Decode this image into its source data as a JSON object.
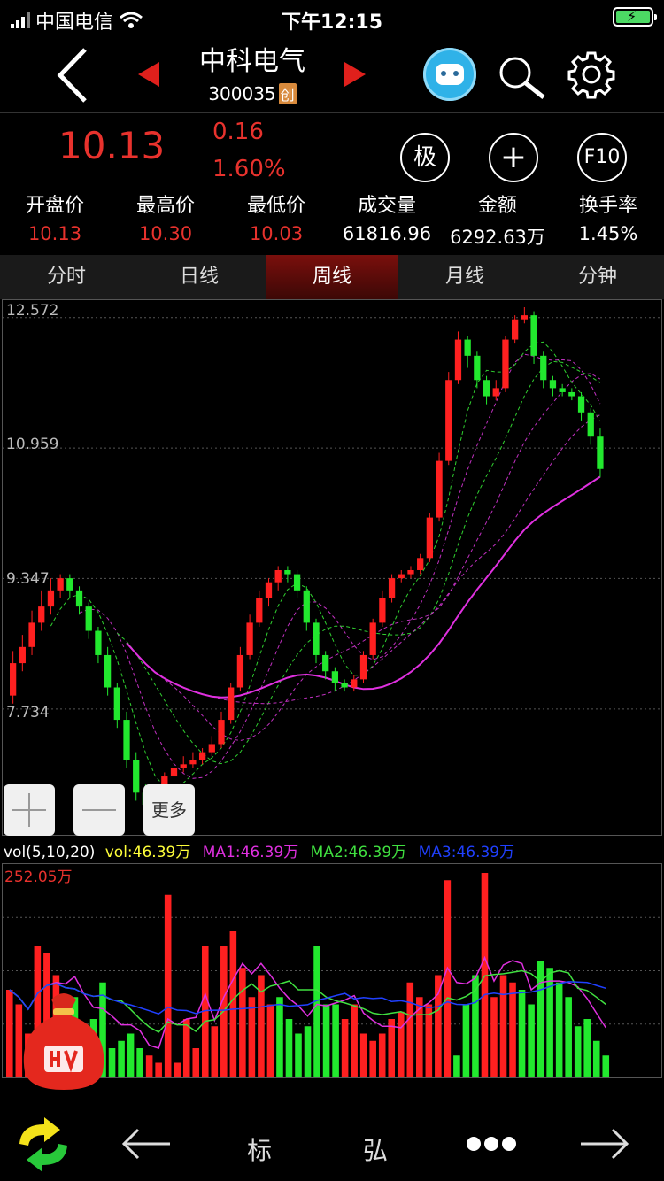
{
  "status": {
    "carrier": "中国电信",
    "time": "下午12:15"
  },
  "header": {
    "name": "中科电气",
    "code": "300035",
    "board": "创"
  },
  "quote": {
    "price": "10.13",
    "change": "0.16",
    "change_pct": "1.60%",
    "buttons": [
      "极",
      "+",
      "F10"
    ],
    "stats": [
      {
        "label": "开盘价",
        "value": "10.13"
      },
      {
        "label": "最高价",
        "value": "10.30"
      },
      {
        "label": "最低价",
        "value": "10.03"
      },
      {
        "label": "成交量",
        "value": "61816.96"
      },
      {
        "label": "金额",
        "value": "6292.63万"
      },
      {
        "label": "换手率",
        "value": "1.45%"
      }
    ]
  },
  "tabs": [
    "分时",
    "日线",
    "周线",
    "月线",
    "分钟"
  ],
  "active_tab": 2,
  "controls": {
    "more": "更多"
  },
  "vol_legend": {
    "title": "vol(5,10,20)",
    "vol": "vol:46.39万",
    "ma1": "MA1:46.39万",
    "ma2": "MA2:46.39万",
    "ma3": "MA3:46.39万"
  },
  "bottom": {
    "biao": "标",
    "hong": "弘"
  },
  "colors": {
    "up": "#ff2020",
    "down": "#22e82e",
    "accent": "#e8322d"
  },
  "chart_data": {
    "type": "candlestick",
    "y_ticks": [
      "12.572",
      "10.959",
      "9.347",
      "7.734"
    ],
    "ylim": [
      6.2,
      12.7
    ],
    "candles": [
      [
        7.9,
        8.3,
        8.45,
        7.8
      ],
      [
        8.3,
        8.5,
        8.65,
        8.2
      ],
      [
        8.5,
        8.8,
        8.95,
        8.4
      ],
      [
        8.8,
        9.0,
        9.2,
        8.7
      ],
      [
        9.0,
        9.2,
        9.35,
        8.9
      ],
      [
        9.2,
        9.35,
        9.4,
        9.1
      ],
      [
        9.35,
        9.2,
        9.4,
        9.1
      ],
      [
        9.2,
        9.0,
        9.25,
        8.9
      ],
      [
        9.0,
        8.7,
        9.05,
        8.6
      ],
      [
        8.7,
        8.4,
        8.75,
        8.3
      ],
      [
        8.4,
        8.0,
        8.5,
        7.9
      ],
      [
        8.0,
        7.6,
        8.05,
        7.5
      ],
      [
        7.6,
        7.1,
        7.7,
        7.0
      ],
      [
        7.1,
        6.7,
        7.2,
        6.6
      ],
      [
        6.7,
        6.55,
        6.8,
        6.5
      ],
      [
        6.55,
        6.6,
        6.7,
        6.5
      ],
      [
        6.6,
        6.9,
        6.95,
        6.55
      ],
      [
        6.9,
        7.0,
        7.1,
        6.85
      ],
      [
        7.0,
        7.05,
        7.15,
        6.95
      ],
      [
        7.05,
        7.1,
        7.2,
        7.0
      ],
      [
        7.1,
        7.2,
        7.25,
        7.05
      ],
      [
        7.2,
        7.3,
        7.4,
        7.15
      ],
      [
        7.3,
        7.6,
        7.7,
        7.25
      ],
      [
        7.6,
        8.0,
        8.05,
        7.55
      ],
      [
        8.0,
        8.4,
        8.5,
        7.95
      ],
      [
        8.4,
        8.8,
        8.9,
        8.35
      ],
      [
        8.8,
        9.1,
        9.2,
        8.75
      ],
      [
        9.1,
        9.3,
        9.35,
        9.0
      ],
      [
        9.3,
        9.45,
        9.5,
        9.2
      ],
      [
        9.45,
        9.4,
        9.5,
        9.3
      ],
      [
        9.4,
        9.2,
        9.45,
        9.1
      ],
      [
        9.2,
        8.8,
        9.25,
        8.7
      ],
      [
        8.8,
        8.4,
        8.85,
        8.3
      ],
      [
        8.4,
        8.2,
        8.45,
        8.1
      ],
      [
        8.2,
        8.05,
        8.25,
        7.95
      ],
      [
        8.05,
        8.0,
        8.1,
        7.95
      ],
      [
        8.0,
        8.1,
        8.15,
        7.95
      ],
      [
        8.1,
        8.4,
        8.45,
        8.05
      ],
      [
        8.4,
        8.8,
        8.85,
        8.35
      ],
      [
        8.8,
        9.1,
        9.2,
        8.75
      ],
      [
        9.1,
        9.35,
        9.4,
        9.05
      ],
      [
        9.35,
        9.4,
        9.45,
        9.3
      ],
      [
        9.4,
        9.45,
        9.5,
        9.35
      ],
      [
        9.45,
        9.6,
        9.65,
        9.4
      ],
      [
        9.6,
        10.1,
        10.15,
        9.55
      ],
      [
        10.1,
        10.8,
        10.9,
        10.05
      ],
      [
        10.8,
        11.8,
        11.9,
        10.75
      ],
      [
        11.8,
        12.3,
        12.4,
        11.75
      ],
      [
        12.3,
        12.1,
        12.35,
        11.95
      ],
      [
        12.1,
        11.8,
        12.15,
        11.7
      ],
      [
        11.8,
        11.6,
        11.85,
        11.5
      ],
      [
        11.6,
        11.7,
        11.8,
        11.55
      ],
      [
        11.7,
        12.3,
        12.35,
        11.65
      ],
      [
        12.3,
        12.55,
        12.6,
        12.25
      ],
      [
        12.55,
        12.6,
        12.7,
        12.5
      ],
      [
        12.6,
        12.1,
        12.65,
        12.0
      ],
      [
        12.1,
        11.8,
        12.15,
        11.7
      ],
      [
        11.8,
        11.7,
        11.85,
        11.6
      ],
      [
        11.7,
        11.65,
        11.75,
        11.6
      ],
      [
        11.65,
        11.6,
        11.7,
        11.55
      ],
      [
        11.6,
        11.4,
        11.65,
        11.3
      ],
      [
        11.4,
        11.1,
        11.45,
        11.0
      ],
      [
        11.1,
        10.7,
        11.2,
        10.6
      ]
    ],
    "vol_ylabel": "252.05万",
    "volumes": [
      120,
      100,
      60,
      180,
      170,
      140,
      90,
      110,
      60,
      80,
      130,
      40,
      50,
      60,
      40,
      30,
      20,
      250,
      20,
      80,
      40,
      180,
      70,
      180,
      200,
      150,
      110,
      140,
      100,
      110,
      80,
      60,
      70,
      180,
      100,
      100,
      80,
      100,
      60,
      50,
      60,
      80,
      90,
      130,
      110,
      100,
      140,
      270,
      30,
      100,
      140,
      280,
      110,
      140,
      130,
      120,
      100,
      160,
      150,
      130,
      110,
      70,
      80,
      50,
      30
    ]
  }
}
